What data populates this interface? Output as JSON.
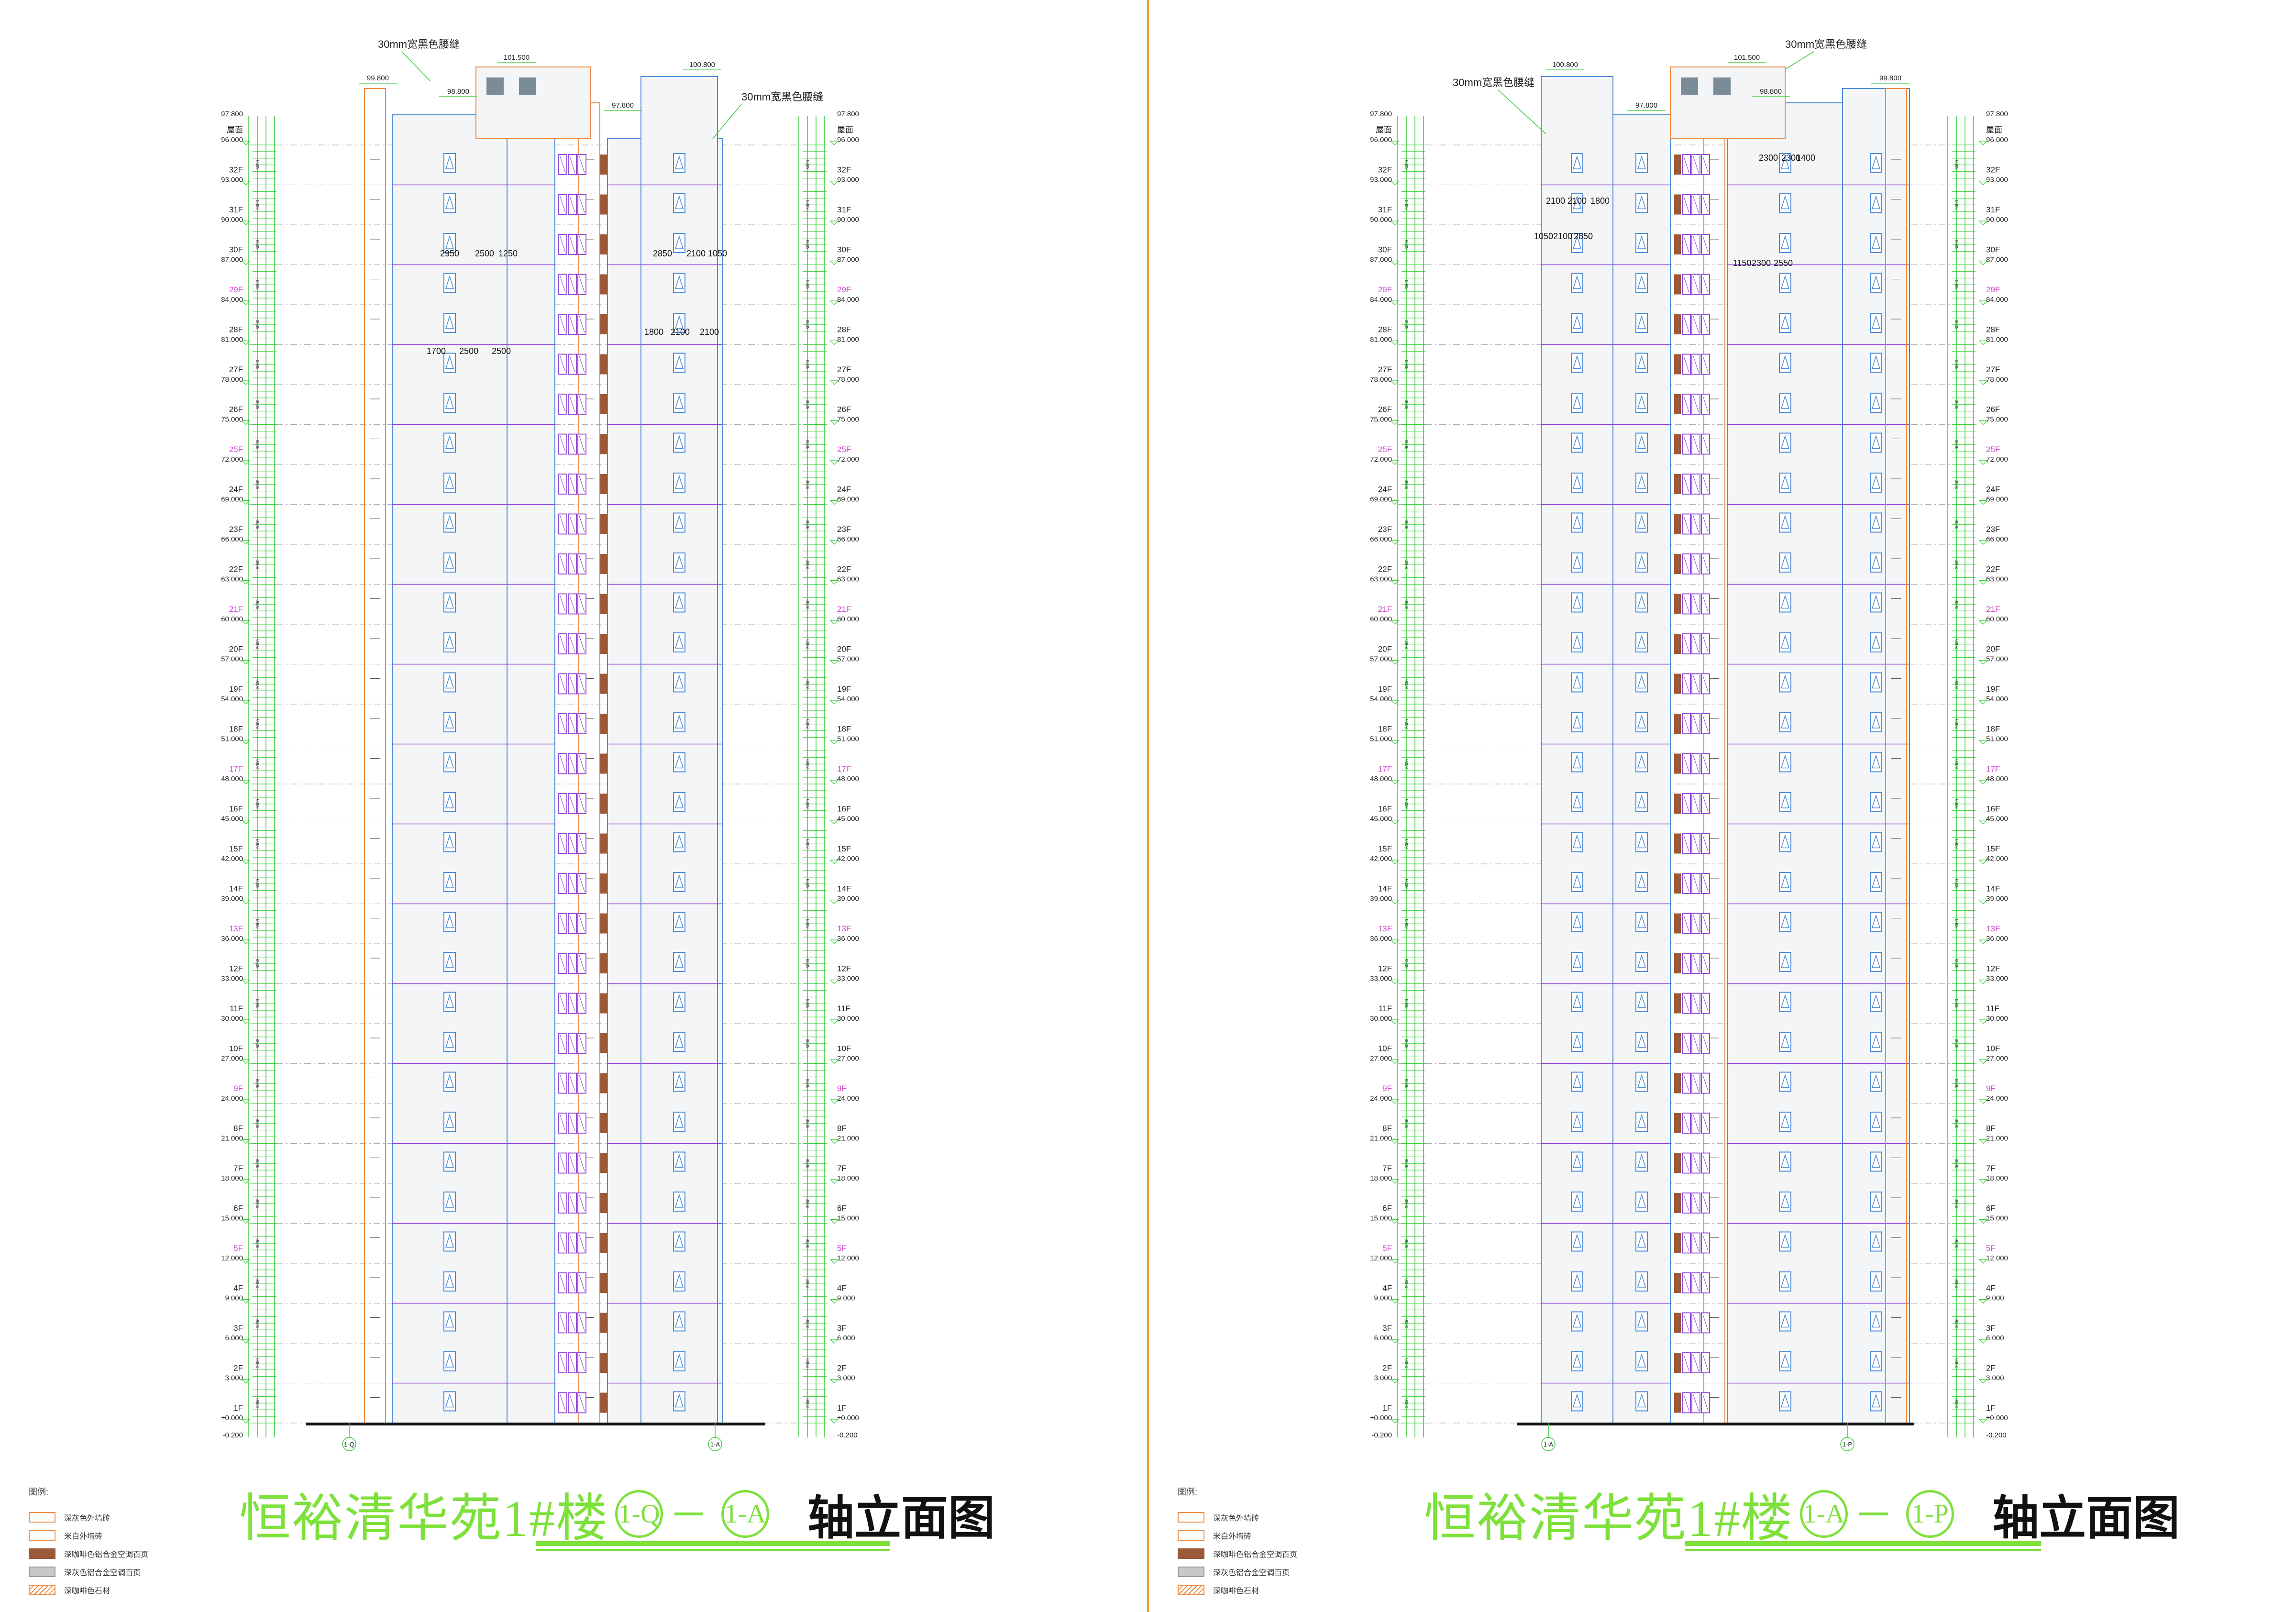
{
  "sheets": [
    {
      "title": "恒裕清华苑1#楼",
      "axis_from": "1-Q",
      "axis_to": "1-A",
      "title_suffix": "轴立面图",
      "axis_labels": [
        "1-Q",
        "1-A"
      ],
      "top_notes": [
        "30mm宽黑色腰缝",
        "30mm宽黑色腰缝"
      ],
      "top_elevations": [
        "99.800",
        "101.500",
        "100.800",
        "98.800",
        "97.800"
      ],
      "dims_upper": [
        "2950",
        "2500",
        "1250",
        "2850",
        "2100",
        "1050"
      ],
      "dims_lower": [
        "1700",
        "2500",
        "2500",
        "1800",
        "2100",
        "2100"
      ]
    },
    {
      "title": "恒裕清华苑1#楼",
      "axis_from": "1-A",
      "axis_to": "1-P",
      "title_suffix": "轴立面图",
      "axis_labels": [
        "1-A",
        "1-P"
      ],
      "top_notes": [
        "30mm宽黑色腰缝",
        "30mm宽黑色腰缝"
      ],
      "top_elevations": [
        "100.800",
        "101.500",
        "99.800",
        "98.800",
        "97.800"
      ],
      "dims_upper": [
        "2100",
        "2100",
        "1800",
        "1050",
        "2100",
        "2850",
        "2300",
        "2300",
        "1400"
      ],
      "dims_lower": [
        "1150",
        "2300",
        "2550"
      ]
    }
  ],
  "floors": [
    {
      "label": "1F",
      "elev": "±0.000"
    },
    {
      "label": "2F",
      "elev": "3.000"
    },
    {
      "label": "3F",
      "elev": "6.000"
    },
    {
      "label": "4F",
      "elev": "9.000"
    },
    {
      "label": "5F",
      "elev": "12.000",
      "accent": true
    },
    {
      "label": "6F",
      "elev": "15.000"
    },
    {
      "label": "7F",
      "elev": "18.000"
    },
    {
      "label": "8F",
      "elev": "21.000"
    },
    {
      "label": "9F",
      "elev": "24.000",
      "accent": true
    },
    {
      "label": "10F",
      "elev": "27.000"
    },
    {
      "label": "11F",
      "elev": "30.000"
    },
    {
      "label": "12F",
      "elev": "33.000"
    },
    {
      "label": "13F",
      "elev": "36.000",
      "accent": true
    },
    {
      "label": "14F",
      "elev": "39.000"
    },
    {
      "label": "15F",
      "elev": "42.000"
    },
    {
      "label": "16F",
      "elev": "45.000"
    },
    {
      "label": "17F",
      "elev": "48.000",
      "accent": true
    },
    {
      "label": "18F",
      "elev": "51.000"
    },
    {
      "label": "19F",
      "elev": "54.000"
    },
    {
      "label": "20F",
      "elev": "57.000"
    },
    {
      "label": "21F",
      "elev": "60.000",
      "accent": true
    },
    {
      "label": "22F",
      "elev": "63.000"
    },
    {
      "label": "23F",
      "elev": "66.000"
    },
    {
      "label": "24F",
      "elev": "69.000"
    },
    {
      "label": "25F",
      "elev": "72.000",
      "accent": true
    },
    {
      "label": "26F",
      "elev": "75.000"
    },
    {
      "label": "27F",
      "elev": "78.000"
    },
    {
      "label": "28F",
      "elev": "81.000"
    },
    {
      "label": "29F",
      "elev": "84.000",
      "accent": true
    },
    {
      "label": "30F",
      "elev": "87.000"
    },
    {
      "label": "31F",
      "elev": "90.000"
    },
    {
      "label": "32F",
      "elev": "93.000"
    },
    {
      "label": "屋面",
      "elev": "96.000"
    }
  ],
  "roof_elev": "97.800",
  "ground_elev": "-0.200",
  "legend": {
    "heading": "图例:",
    "items": [
      {
        "label": "深灰色外墙砖",
        "color": "#ffffff",
        "border": "#f08a40"
      },
      {
        "label": "米白外墙砖",
        "color": "#ffffff",
        "border": "#f08a40"
      },
      {
        "label": "深咖啡色铝合金空调百页",
        "color": "#9a5a3a",
        "border": "#9a5a3a"
      },
      {
        "label": "深灰色铝合金空调百页",
        "color": "#c8c8c8",
        "border": "#999999"
      },
      {
        "label": "深咖啡色石材",
        "color": "#ffffff",
        "border": "#f08a40",
        "hatch": true
      }
    ]
  },
  "colors": {
    "title_green": "#7ee03a",
    "dim_green": "#33cc33",
    "wall_orange": "#f08a40",
    "glass_blue": "#4a8ad8",
    "floor_purple": "#8a3ad8",
    "frame_orange": "#f2a040"
  }
}
